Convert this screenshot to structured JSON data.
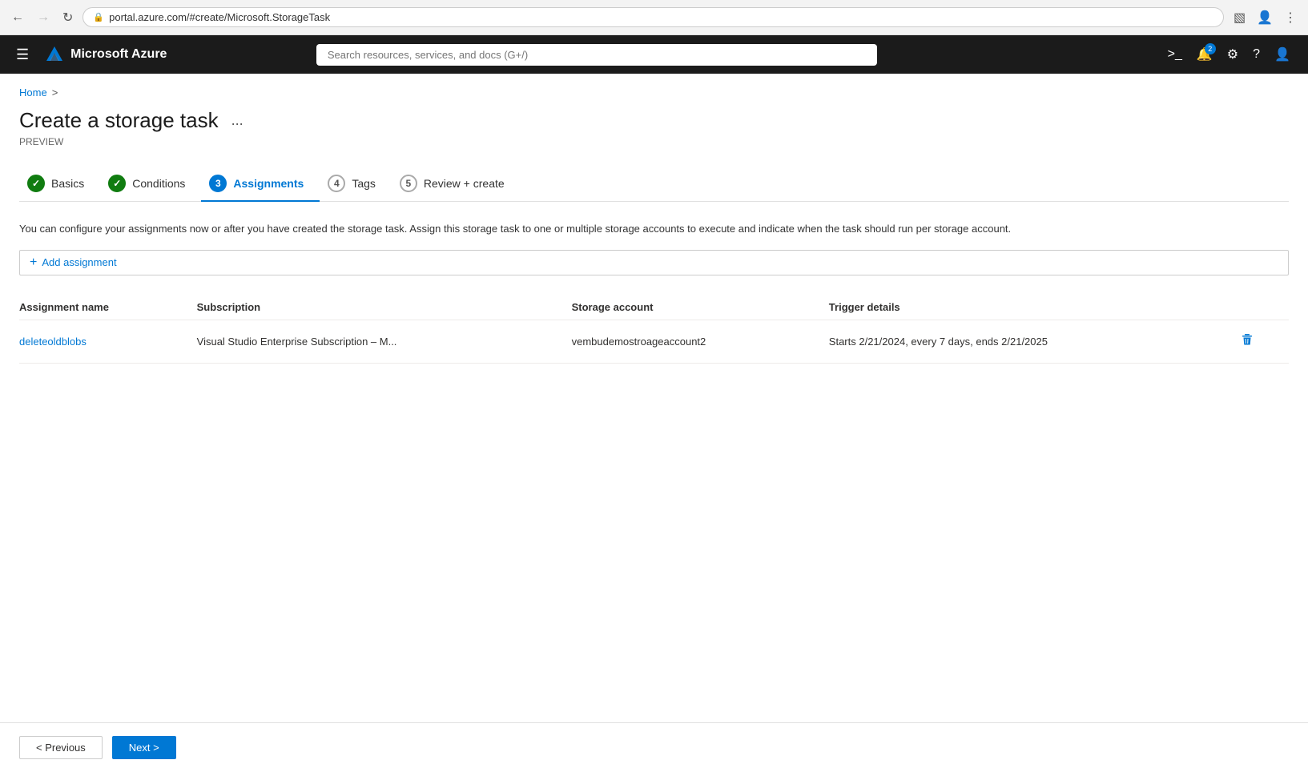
{
  "browser": {
    "url": "portal.azure.com/#create/Microsoft.StorageTask",
    "back_disabled": false,
    "forward_disabled": true
  },
  "azure_header": {
    "title": "Microsoft Azure",
    "search_placeholder": "Search resources, services, and docs (G+/)",
    "notification_count": "2"
  },
  "breadcrumb": {
    "home": "Home"
  },
  "page": {
    "title": "Create a storage task",
    "subtitle": "PREVIEW",
    "more_label": "..."
  },
  "steps": [
    {
      "number": "1",
      "label": "Basics",
      "state": "completed"
    },
    {
      "number": "2",
      "label": "Conditions",
      "state": "completed"
    },
    {
      "number": "3",
      "label": "Assignments",
      "state": "active"
    },
    {
      "number": "4",
      "label": "Tags",
      "state": "inactive"
    },
    {
      "number": "5",
      "label": "Review + create",
      "state": "inactive"
    }
  ],
  "description": "You can configure your assignments now or after you have created the storage task. Assign this storage task to one or multiple storage accounts to execute and indicate when the task should run per storage account.",
  "add_assignment_label": "Add assignment",
  "table": {
    "headers": [
      "Assignment name",
      "Subscription",
      "Storage account",
      "Trigger details"
    ],
    "rows": [
      {
        "name": "deleteoldblobs",
        "subscription": "Visual Studio Enterprise Subscription – M...",
        "storage_account": "vembudemostroageaccount2",
        "trigger": "Starts 2/21/2024, every 7 days, ends 2/21/2025"
      }
    ]
  },
  "footer": {
    "previous_label": "< Previous",
    "next_label": "Next >"
  }
}
